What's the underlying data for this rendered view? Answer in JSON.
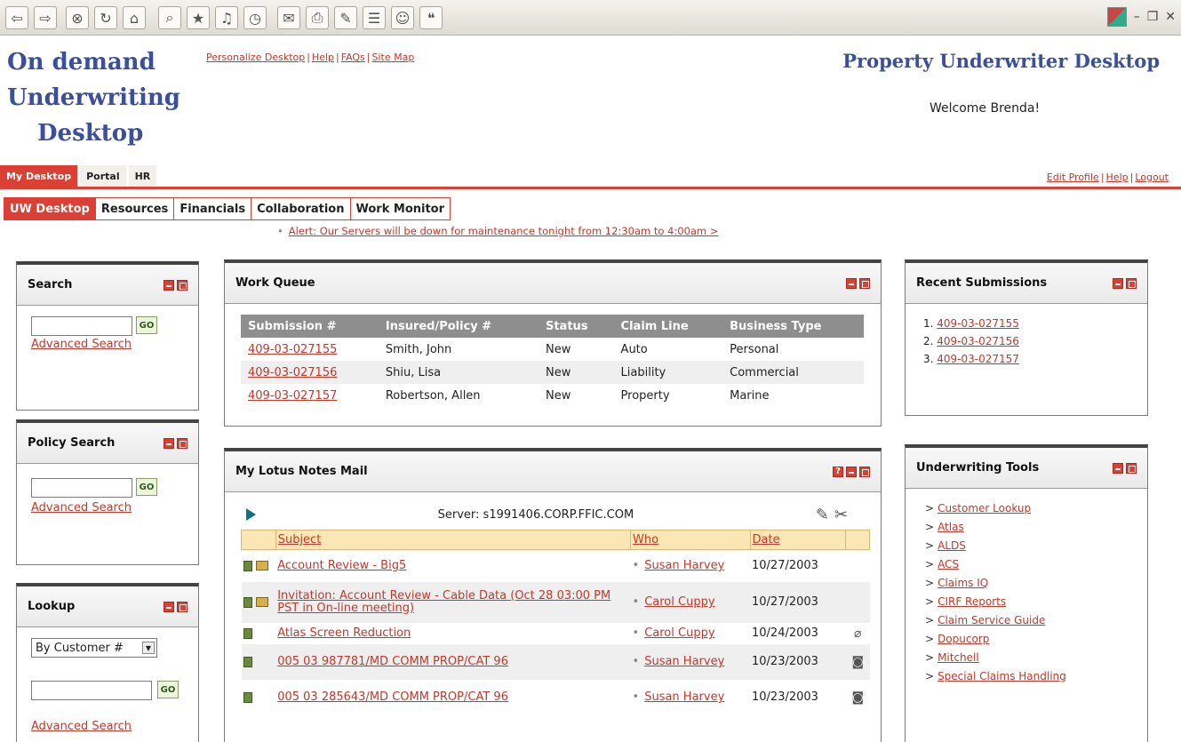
{
  "browser": {
    "toolbar_icons": [
      "back-icon",
      "forward-icon",
      "stop-icon",
      "refresh-icon",
      "home-icon",
      "search-icon",
      "favorites-icon",
      "media-icon",
      "history-icon",
      "mail-icon",
      "print-icon",
      "edit-icon",
      "discuss-icon",
      "messenger-icon",
      "chat-icon"
    ],
    "controls": {
      "minimize": "–",
      "restore": "❐",
      "close": "✕"
    }
  },
  "header": {
    "brand_line1": "On demand",
    "brand_line2": "Underwriting",
    "brand_line3": "Desktop",
    "links": [
      "Personalize Desktop",
      "Help",
      "FAQs",
      "Site Map"
    ],
    "app_title": "Property Underwriter Desktop",
    "welcome": "Welcome Brenda!"
  },
  "tabs_primary": [
    "My Desktop",
    "Portal",
    "HR"
  ],
  "user_links": [
    "Edit Profile",
    "Help",
    "Logout"
  ],
  "tabs_secondary": [
    "UW Desktop",
    "Resources",
    "Financials",
    "Collaboration",
    "Work Monitor"
  ],
  "alert": "Alert: Our Servers will be down for maintenance tonight from 12:30am to 4:00am >",
  "search_panel": {
    "title": "Search",
    "go": "GO",
    "advanced": "Advanced Search"
  },
  "policy_panel": {
    "title": "Policy Search",
    "go": "GO",
    "advanced": "Advanced Search"
  },
  "lookup_panel": {
    "title": "Lookup",
    "select_value": "By Customer #",
    "go": "GO",
    "advanced": "Advanced Search"
  },
  "work_queue": {
    "title": "Work Queue",
    "columns": [
      "Submission #",
      "Insured/Policy #",
      "Status",
      "Claim Line",
      "Business Type"
    ],
    "rows": [
      [
        "409-03-027155",
        "Smith, John",
        "New",
        "Auto",
        "Personal"
      ],
      [
        "409-03-027156",
        "Shiu, Lisa",
        "New",
        "Liability",
        "Commercial"
      ],
      [
        "409-03-027157",
        "Robertson, Allen",
        "New",
        "Property",
        "Marine"
      ]
    ]
  },
  "recent": {
    "title": "Recent Submissions",
    "items": [
      "409-03-027155",
      "409-03-027156",
      "409-03-027157"
    ]
  },
  "mail": {
    "title": "My Lotus Notes Mail",
    "server": "Server: s1991406.CORP.FFIC.COM",
    "columns": [
      "Subject",
      "Who",
      "Date"
    ],
    "rows": [
      [
        "Account Review - Big5",
        "Susan Harvey",
        "10/27/2003"
      ],
      [
        "Invitation: Account Review - Cable Data (Oct 28 03:00 PM PST in On-line meeting)",
        "Carol Cuppy",
        "10/27/2003"
      ],
      [
        "Atlas Screen Reduction",
        "Carol Cuppy",
        "10/24/2003"
      ],
      [
        "005 03 987781/MD COMM PROP/CAT 96",
        "Susan Harvey",
        "10/23/2003"
      ],
      [
        "005 03 285643/MD COMM PROP/CAT 96",
        "Susan Harvey",
        "10/23/2003"
      ]
    ]
  },
  "tools": {
    "title": "Underwriting Tools",
    "items": [
      "Customer Lookup",
      "Atlas",
      "ALDS",
      "ACS",
      "Claims IQ",
      "CIRF Reports",
      "Claim Service Guide",
      "Dopucorp",
      "Mitchell",
      "Special Claims Handling"
    ]
  },
  "colors": {
    "accent": "#dc3f34",
    "brand": "#3c4f9b",
    "link": "#c0392b"
  }
}
